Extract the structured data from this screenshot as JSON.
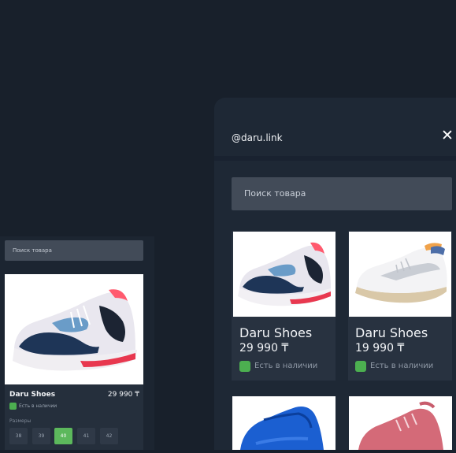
{
  "left_panel": {
    "search": {
      "placeholder": "Поиск товара"
    },
    "product": {
      "title": "Daru Shoes",
      "price": "29 990 ₸",
      "stock": "Есть в наличии"
    },
    "sizes_label": "Размеры",
    "sizes": [
      "38",
      "39",
      "40",
      "41",
      "42"
    ],
    "selected_size": "40"
  },
  "right_panel": {
    "handle": "@daru.link",
    "close_icon": "close-icon",
    "search": {
      "placeholder": "Поиск товара"
    },
    "products": [
      {
        "title": "Daru Shoes",
        "price": "29 990 ₸",
        "stock": "Есть в наличии"
      },
      {
        "title": "Daru Shoes",
        "price": "19 990 ₸",
        "stock": "Есть в наличии"
      }
    ]
  },
  "colors": {
    "background": "#18202b",
    "accent_green": "#4caf50",
    "selected_size": "#5cb85c"
  }
}
